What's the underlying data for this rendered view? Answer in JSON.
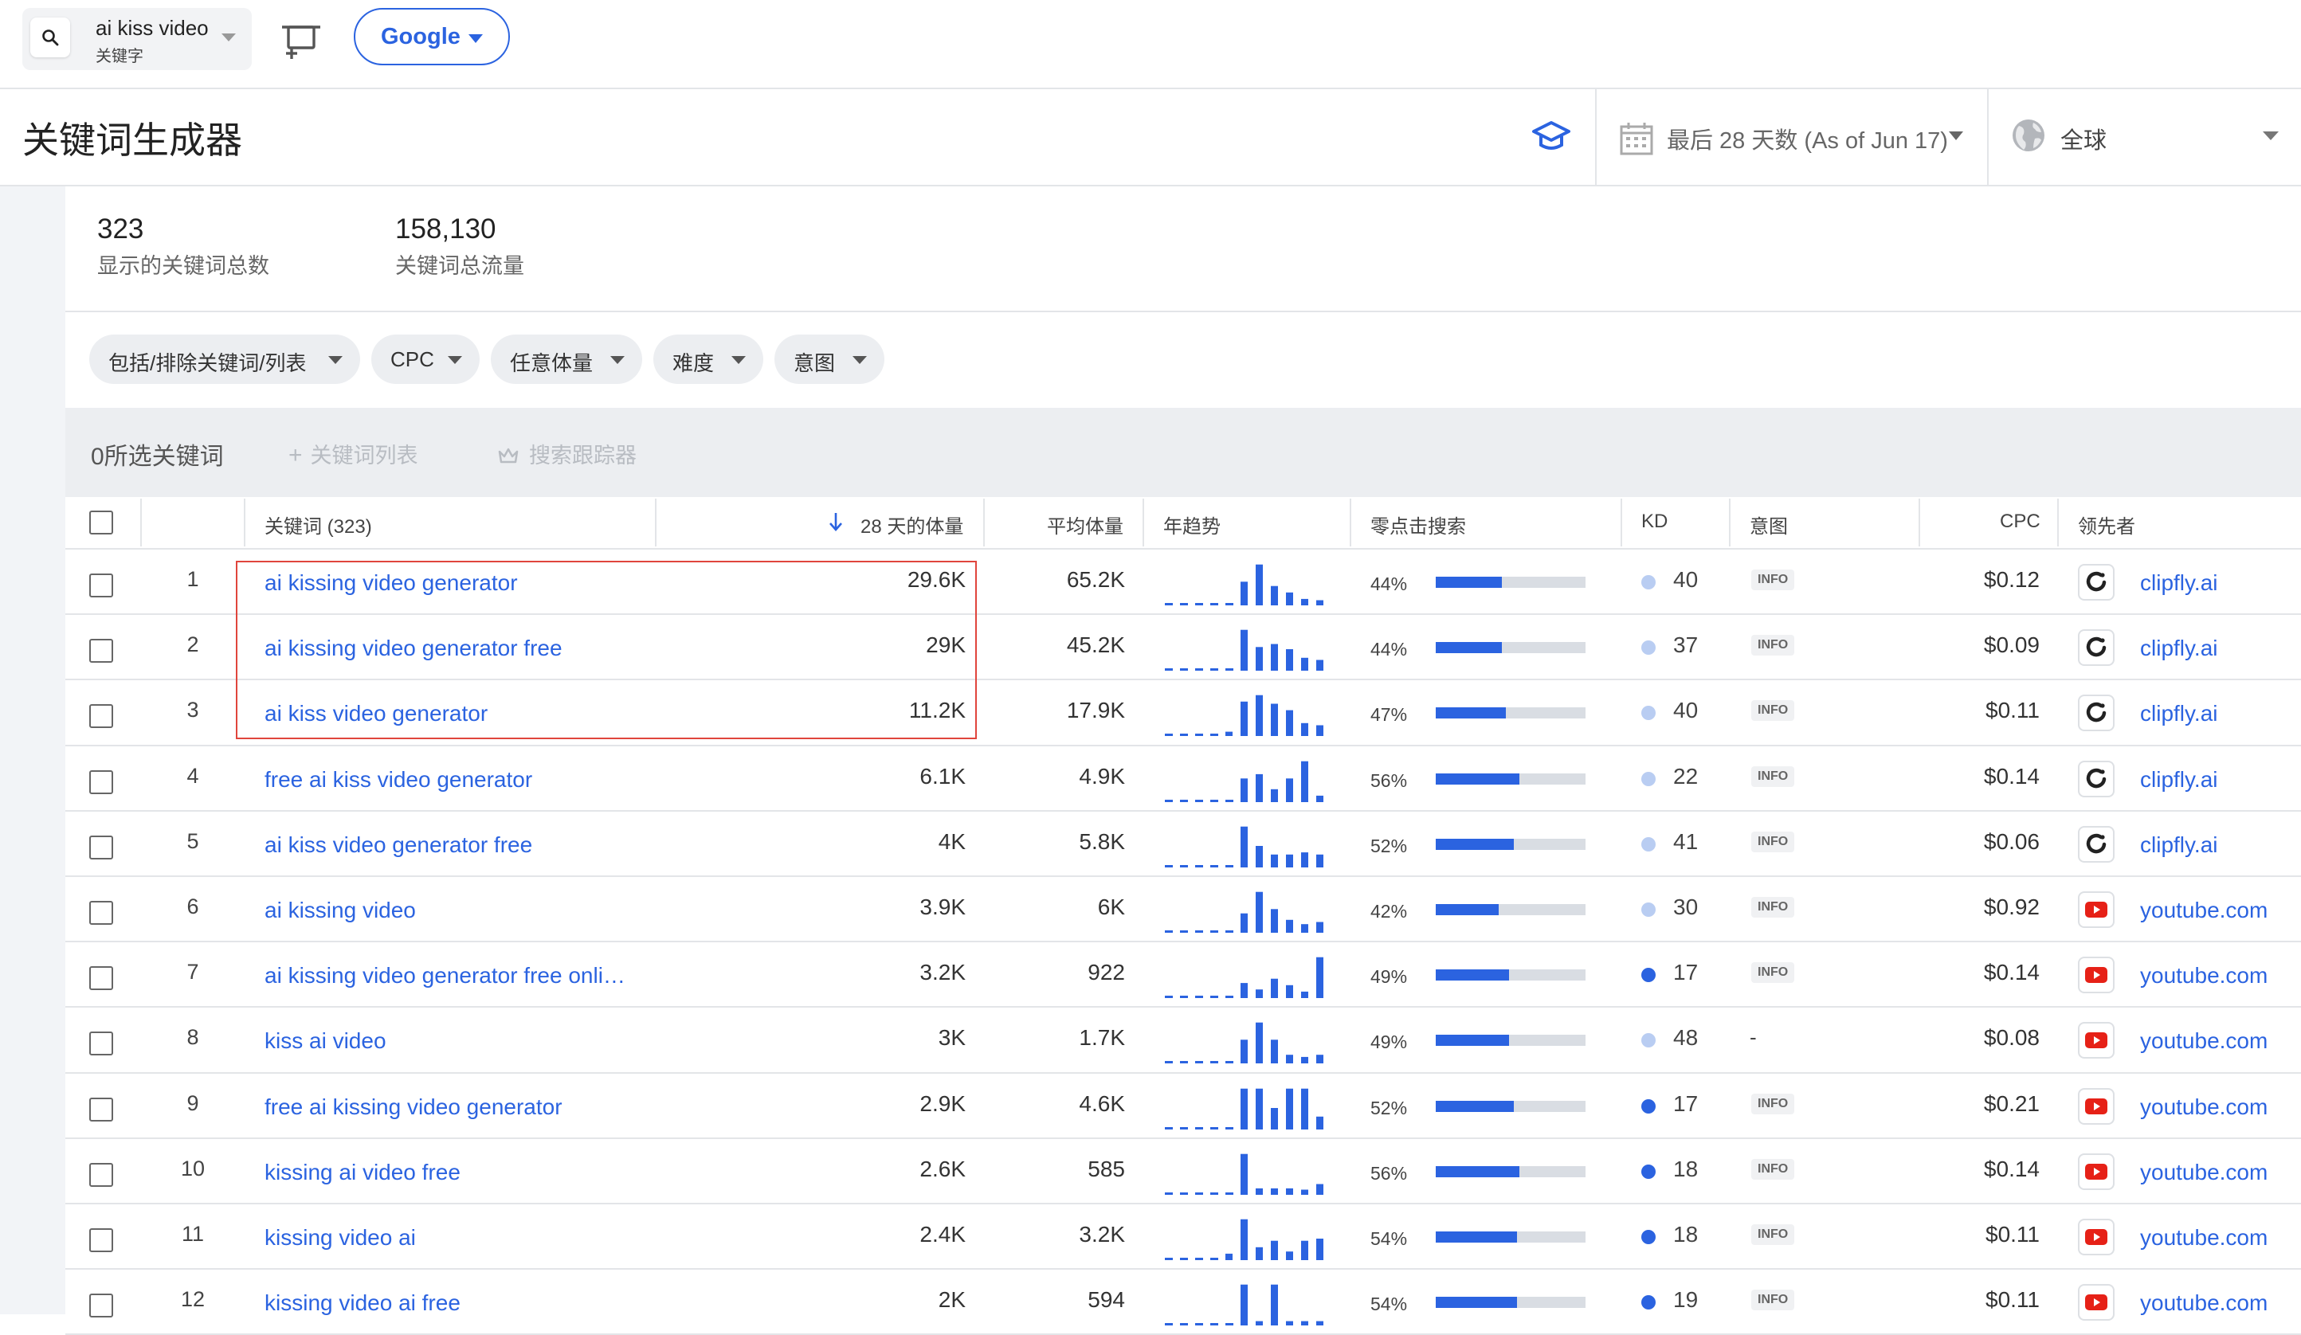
{
  "search": {
    "query": "ai kiss video",
    "type_label": "关键字",
    "engine": "Google"
  },
  "header": {
    "title": "关键词生成器",
    "date_range": "最后 28 天数 (As of Jun 17)",
    "region": "全球"
  },
  "stats": [
    {
      "value": "323",
      "label": "显示的关键词总数"
    },
    {
      "value": "158,130",
      "label": "关键词总流量"
    }
  ],
  "filters": [
    "包括/排除关键词/列表",
    "CPC",
    "任意体量",
    "难度",
    "意图"
  ],
  "selection": {
    "count_label": "0所选关键词",
    "add_list": "关键词列表",
    "tracker": "搜索跟踪器"
  },
  "columns": {
    "keyword": "关键词 (323)",
    "volume28": "28 天的体量",
    "avg": "平均体量",
    "trend": "年趋势",
    "zero_click": "零点击搜索",
    "kd": "KD",
    "intent": "意图",
    "cpc": "CPC",
    "leader": "领先者"
  },
  "colors": {
    "accent": "#2b63e0",
    "kd_easy": "#b9cdf2",
    "kd_hard": "#2b63e0",
    "highlight_box": "#e0453c",
    "youtube_red": "#e62117"
  },
  "highlight_rows": [
    1,
    2,
    3
  ],
  "rows": [
    {
      "n": "1",
      "kw": "ai kissing video generator",
      "vol": "29.6K",
      "avg": "65.2K",
      "trend": [
        0.04,
        0.04,
        0.04,
        0.04,
        0.04,
        0.55,
        0.95,
        0.45,
        0.3,
        0.15,
        0.12
      ],
      "zero_pct": "44%",
      "zero": 0.44,
      "kd": "40",
      "kd_level": "easy",
      "intent": "INFO",
      "cpc": "$0.12",
      "leader_icon": "clipfly-icon",
      "leader": "clipfly.ai"
    },
    {
      "n": "2",
      "kw": "ai kissing video generator free",
      "vol": "29K",
      "avg": "45.2K",
      "trend": [
        0.04,
        0.04,
        0.04,
        0.04,
        0.04,
        0.95,
        0.55,
        0.62,
        0.5,
        0.3,
        0.25
      ],
      "zero_pct": "44%",
      "zero": 0.44,
      "kd": "37",
      "kd_level": "easy",
      "intent": "INFO",
      "cpc": "$0.09",
      "leader_icon": "clipfly-icon",
      "leader": "clipfly.ai"
    },
    {
      "n": "3",
      "kw": "ai kiss video generator",
      "vol": "11.2K",
      "avg": "17.9K",
      "trend": [
        0.04,
        0.04,
        0.04,
        0.04,
        0.1,
        0.8,
        0.95,
        0.75,
        0.6,
        0.3,
        0.25
      ],
      "zero_pct": "47%",
      "zero": 0.47,
      "kd": "40",
      "kd_level": "easy",
      "intent": "INFO",
      "cpc": "$0.11",
      "leader_icon": "clipfly-icon",
      "leader": "clipfly.ai"
    },
    {
      "n": "4",
      "kw": "free ai kiss video generator",
      "vol": "6.1K",
      "avg": "4.9K",
      "trend": [
        0.04,
        0.04,
        0.04,
        0.04,
        0.04,
        0.55,
        0.65,
        0.3,
        0.55,
        0.95,
        0.15
      ],
      "zero_pct": "56%",
      "zero": 0.56,
      "kd": "22",
      "kd_level": "easy",
      "intent": "INFO",
      "cpc": "$0.14",
      "leader_icon": "clipfly-icon",
      "leader": "clipfly.ai"
    },
    {
      "n": "5",
      "kw": "ai kiss video generator free",
      "vol": "4K",
      "avg": "5.8K",
      "trend": [
        0.04,
        0.04,
        0.04,
        0.04,
        0.04,
        0.95,
        0.5,
        0.3,
        0.3,
        0.35,
        0.3
      ],
      "zero_pct": "52%",
      "zero": 0.52,
      "kd": "41",
      "kd_level": "easy",
      "intent": "INFO",
      "cpc": "$0.06",
      "leader_icon": "clipfly-icon",
      "leader": "clipfly.ai"
    },
    {
      "n": "6",
      "kw": "ai kissing video",
      "vol": "3.9K",
      "avg": "6K",
      "trend": [
        0.04,
        0.04,
        0.04,
        0.04,
        0.04,
        0.45,
        0.95,
        0.55,
        0.3,
        0.2,
        0.25
      ],
      "zero_pct": "42%",
      "zero": 0.42,
      "kd": "30",
      "kd_level": "easy",
      "intent": "INFO",
      "cpc": "$0.92",
      "leader_icon": "youtube-icon",
      "leader": "youtube.com"
    },
    {
      "n": "7",
      "kw": "ai kissing video generator free onli…",
      "vol": "3.2K",
      "avg": "922",
      "trend": [
        0.04,
        0.04,
        0.04,
        0.04,
        0.04,
        0.35,
        0.2,
        0.45,
        0.3,
        0.15,
        0.95
      ],
      "zero_pct": "49%",
      "zero": 0.49,
      "kd": "17",
      "kd_level": "hard",
      "intent": "INFO",
      "cpc": "$0.14",
      "leader_icon": "youtube-icon",
      "leader": "youtube.com"
    },
    {
      "n": "8",
      "kw": "kiss ai video",
      "vol": "3K",
      "avg": "1.7K",
      "trend": [
        0.04,
        0.04,
        0.04,
        0.04,
        0.04,
        0.55,
        0.95,
        0.55,
        0.2,
        0.15,
        0.2
      ],
      "zero_pct": "49%",
      "zero": 0.49,
      "kd": "48",
      "kd_level": "easy",
      "intent": "-",
      "cpc": "$0.08",
      "leader_icon": "youtube-icon",
      "leader": "youtube.com"
    },
    {
      "n": "9",
      "kw": "free ai kissing video generator",
      "vol": "2.9K",
      "avg": "4.6K",
      "trend": [
        0.04,
        0.04,
        0.04,
        0.04,
        0.04,
        0.95,
        0.95,
        0.5,
        0.95,
        0.95,
        0.3
      ],
      "zero_pct": "52%",
      "zero": 0.52,
      "kd": "17",
      "kd_level": "hard",
      "intent": "INFO",
      "cpc": "$0.21",
      "leader_icon": "youtube-icon",
      "leader": "youtube.com"
    },
    {
      "n": "10",
      "kw": "kissing ai video free",
      "vol": "2.6K",
      "avg": "585",
      "trend": [
        0.04,
        0.04,
        0.04,
        0.04,
        0.04,
        0.95,
        0.15,
        0.15,
        0.15,
        0.12,
        0.25
      ],
      "zero_pct": "56%",
      "zero": 0.56,
      "kd": "18",
      "kd_level": "hard",
      "intent": "INFO",
      "cpc": "$0.14",
      "leader_icon": "youtube-icon",
      "leader": "youtube.com"
    },
    {
      "n": "11",
      "kw": "kissing video ai",
      "vol": "2.4K",
      "avg": "3.2K",
      "trend": [
        0.04,
        0.04,
        0.04,
        0.04,
        0.15,
        0.95,
        0.3,
        0.45,
        0.2,
        0.45,
        0.5
      ],
      "zero_pct": "54%",
      "zero": 0.54,
      "kd": "18",
      "kd_level": "hard",
      "intent": "INFO",
      "cpc": "$0.11",
      "leader_icon": "youtube-icon",
      "leader": "youtube.com"
    },
    {
      "n": "12",
      "kw": "kissing video ai free",
      "vol": "2K",
      "avg": "594",
      "trend": [
        0.04,
        0.04,
        0.04,
        0.04,
        0.04,
        0.95,
        0.1,
        0.95,
        0.1,
        0.1,
        0.1
      ],
      "zero_pct": "54%",
      "zero": 0.54,
      "kd": "19",
      "kd_level": "hard",
      "intent": "INFO",
      "cpc": "$0.11",
      "leader_icon": "youtube-icon",
      "leader": "youtube.com"
    }
  ]
}
